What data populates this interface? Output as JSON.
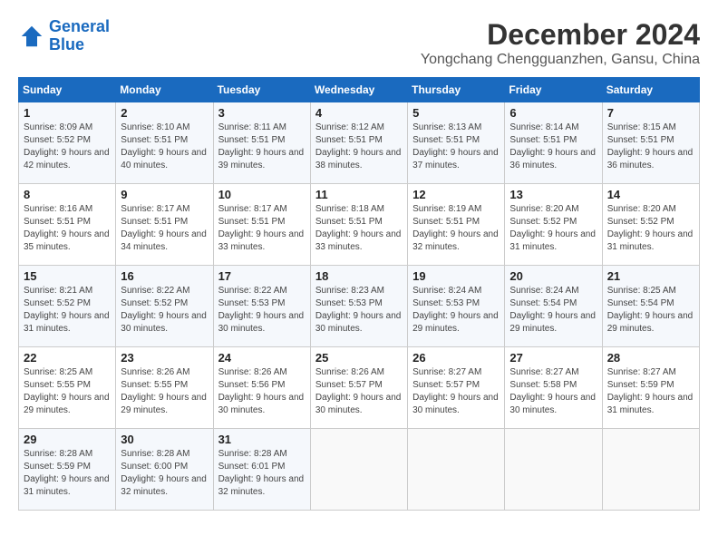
{
  "header": {
    "logo_line1": "General",
    "logo_line2": "Blue",
    "month_title": "December 2024",
    "location": "Yongchang Chengguanzhen, Gansu, China"
  },
  "days_of_week": [
    "Sunday",
    "Monday",
    "Tuesday",
    "Wednesday",
    "Thursday",
    "Friday",
    "Saturday"
  ],
  "weeks": [
    [
      {
        "day": "1",
        "sunrise": "Sunrise: 8:09 AM",
        "sunset": "Sunset: 5:52 PM",
        "daylight": "Daylight: 9 hours and 42 minutes."
      },
      {
        "day": "2",
        "sunrise": "Sunrise: 8:10 AM",
        "sunset": "Sunset: 5:51 PM",
        "daylight": "Daylight: 9 hours and 40 minutes."
      },
      {
        "day": "3",
        "sunrise": "Sunrise: 8:11 AM",
        "sunset": "Sunset: 5:51 PM",
        "daylight": "Daylight: 9 hours and 39 minutes."
      },
      {
        "day": "4",
        "sunrise": "Sunrise: 8:12 AM",
        "sunset": "Sunset: 5:51 PM",
        "daylight": "Daylight: 9 hours and 38 minutes."
      },
      {
        "day": "5",
        "sunrise": "Sunrise: 8:13 AM",
        "sunset": "Sunset: 5:51 PM",
        "daylight": "Daylight: 9 hours and 37 minutes."
      },
      {
        "day": "6",
        "sunrise": "Sunrise: 8:14 AM",
        "sunset": "Sunset: 5:51 PM",
        "daylight": "Daylight: 9 hours and 36 minutes."
      },
      {
        "day": "7",
        "sunrise": "Sunrise: 8:15 AM",
        "sunset": "Sunset: 5:51 PM",
        "daylight": "Daylight: 9 hours and 36 minutes."
      }
    ],
    [
      {
        "day": "8",
        "sunrise": "Sunrise: 8:16 AM",
        "sunset": "Sunset: 5:51 PM",
        "daylight": "Daylight: 9 hours and 35 minutes."
      },
      {
        "day": "9",
        "sunrise": "Sunrise: 8:17 AM",
        "sunset": "Sunset: 5:51 PM",
        "daylight": "Daylight: 9 hours and 34 minutes."
      },
      {
        "day": "10",
        "sunrise": "Sunrise: 8:17 AM",
        "sunset": "Sunset: 5:51 PM",
        "daylight": "Daylight: 9 hours and 33 minutes."
      },
      {
        "day": "11",
        "sunrise": "Sunrise: 8:18 AM",
        "sunset": "Sunset: 5:51 PM",
        "daylight": "Daylight: 9 hours and 33 minutes."
      },
      {
        "day": "12",
        "sunrise": "Sunrise: 8:19 AM",
        "sunset": "Sunset: 5:51 PM",
        "daylight": "Daylight: 9 hours and 32 minutes."
      },
      {
        "day": "13",
        "sunrise": "Sunrise: 8:20 AM",
        "sunset": "Sunset: 5:52 PM",
        "daylight": "Daylight: 9 hours and 31 minutes."
      },
      {
        "day": "14",
        "sunrise": "Sunrise: 8:20 AM",
        "sunset": "Sunset: 5:52 PM",
        "daylight": "Daylight: 9 hours and 31 minutes."
      }
    ],
    [
      {
        "day": "15",
        "sunrise": "Sunrise: 8:21 AM",
        "sunset": "Sunset: 5:52 PM",
        "daylight": "Daylight: 9 hours and 31 minutes."
      },
      {
        "day": "16",
        "sunrise": "Sunrise: 8:22 AM",
        "sunset": "Sunset: 5:52 PM",
        "daylight": "Daylight: 9 hours and 30 minutes."
      },
      {
        "day": "17",
        "sunrise": "Sunrise: 8:22 AM",
        "sunset": "Sunset: 5:53 PM",
        "daylight": "Daylight: 9 hours and 30 minutes."
      },
      {
        "day": "18",
        "sunrise": "Sunrise: 8:23 AM",
        "sunset": "Sunset: 5:53 PM",
        "daylight": "Daylight: 9 hours and 30 minutes."
      },
      {
        "day": "19",
        "sunrise": "Sunrise: 8:24 AM",
        "sunset": "Sunset: 5:53 PM",
        "daylight": "Daylight: 9 hours and 29 minutes."
      },
      {
        "day": "20",
        "sunrise": "Sunrise: 8:24 AM",
        "sunset": "Sunset: 5:54 PM",
        "daylight": "Daylight: 9 hours and 29 minutes."
      },
      {
        "day": "21",
        "sunrise": "Sunrise: 8:25 AM",
        "sunset": "Sunset: 5:54 PM",
        "daylight": "Daylight: 9 hours and 29 minutes."
      }
    ],
    [
      {
        "day": "22",
        "sunrise": "Sunrise: 8:25 AM",
        "sunset": "Sunset: 5:55 PM",
        "daylight": "Daylight: 9 hours and 29 minutes."
      },
      {
        "day": "23",
        "sunrise": "Sunrise: 8:26 AM",
        "sunset": "Sunset: 5:55 PM",
        "daylight": "Daylight: 9 hours and 29 minutes."
      },
      {
        "day": "24",
        "sunrise": "Sunrise: 8:26 AM",
        "sunset": "Sunset: 5:56 PM",
        "daylight": "Daylight: 9 hours and 30 minutes."
      },
      {
        "day": "25",
        "sunrise": "Sunrise: 8:26 AM",
        "sunset": "Sunset: 5:57 PM",
        "daylight": "Daylight: 9 hours and 30 minutes."
      },
      {
        "day": "26",
        "sunrise": "Sunrise: 8:27 AM",
        "sunset": "Sunset: 5:57 PM",
        "daylight": "Daylight: 9 hours and 30 minutes."
      },
      {
        "day": "27",
        "sunrise": "Sunrise: 8:27 AM",
        "sunset": "Sunset: 5:58 PM",
        "daylight": "Daylight: 9 hours and 30 minutes."
      },
      {
        "day": "28",
        "sunrise": "Sunrise: 8:27 AM",
        "sunset": "Sunset: 5:59 PM",
        "daylight": "Daylight: 9 hours and 31 minutes."
      }
    ],
    [
      {
        "day": "29",
        "sunrise": "Sunrise: 8:28 AM",
        "sunset": "Sunset: 5:59 PM",
        "daylight": "Daylight: 9 hours and 31 minutes."
      },
      {
        "day": "30",
        "sunrise": "Sunrise: 8:28 AM",
        "sunset": "Sunset: 6:00 PM",
        "daylight": "Daylight: 9 hours and 32 minutes."
      },
      {
        "day": "31",
        "sunrise": "Sunrise: 8:28 AM",
        "sunset": "Sunset: 6:01 PM",
        "daylight": "Daylight: 9 hours and 32 minutes."
      },
      null,
      null,
      null,
      null
    ]
  ]
}
